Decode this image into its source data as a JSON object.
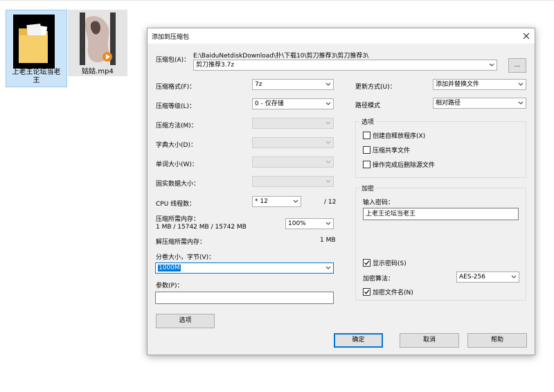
{
  "desktop": {
    "items": [
      {
        "label_line1": "上老王论坛当老",
        "label_line2": "王"
      },
      {
        "label": "姑姑.mp4"
      }
    ]
  },
  "dialog": {
    "title": "添加到压缩包",
    "archive": {
      "label": "压缩包(A)：",
      "path": "E:\\BaiduNetdiskDownload\\扑\\下载10\\剪刀推荐3\\剪刀推荐3\\",
      "name": "剪刀推荐3.7z",
      "browse_label": "..."
    },
    "left": {
      "format": {
        "label": "压缩格式(F)：",
        "value": "7z"
      },
      "level": {
        "label": "压缩等级(L)：",
        "value": "0 - 仅存储"
      },
      "method": {
        "label": "压缩方法(M)："
      },
      "dict": {
        "label": "字典大小(D)："
      },
      "word": {
        "label": "单词大小(W)："
      },
      "solid": {
        "label": "固实数据大小："
      },
      "cpu": {
        "label": "CPU 线程数：",
        "value": "* 12",
        "max": "/ 12"
      },
      "mem_compress": {
        "label": "压缩所需内存：",
        "detail": "1 MB / 15742 MB / 15742 MB",
        "value": "100%"
      },
      "mem_decompress": {
        "label": "解压缩所需内存：",
        "value": "1 MB"
      },
      "volume": {
        "label": "分卷大小，字节(V)：",
        "value": "1000M"
      },
      "params": {
        "label": "参数(P)：",
        "value": ""
      },
      "options_button": "选项"
    },
    "right": {
      "update": {
        "label": "更新方式(U)：",
        "value": "添加并替换文件"
      },
      "path_mode": {
        "label": "路径模式",
        "value": "相对路径"
      },
      "options_group": {
        "title": "选项",
        "sfx": {
          "label": "创建自释放程序(X)",
          "checked": false
        },
        "shared": {
          "label": "压缩共享文件",
          "checked": false
        },
        "delete": {
          "label": "操作完成后删除源文件",
          "checked": false
        }
      },
      "encryption_group": {
        "title": "加密",
        "password_label": "输入密码：",
        "password_value": "上老王论坛当老王",
        "show_password": {
          "label": "显示密码(S)",
          "checked": true
        },
        "method_label": "加密算法：",
        "method_value": "AES-256",
        "encrypt_names": {
          "label": "加密文件名(N)",
          "checked": true
        }
      }
    },
    "buttons": {
      "ok": "确定",
      "cancel": "取消",
      "help": "帮助"
    }
  },
  "colors": {
    "accent": "#0078d7",
    "dialog_bg": "#f0f0f0",
    "selection": "#cce4f7"
  }
}
